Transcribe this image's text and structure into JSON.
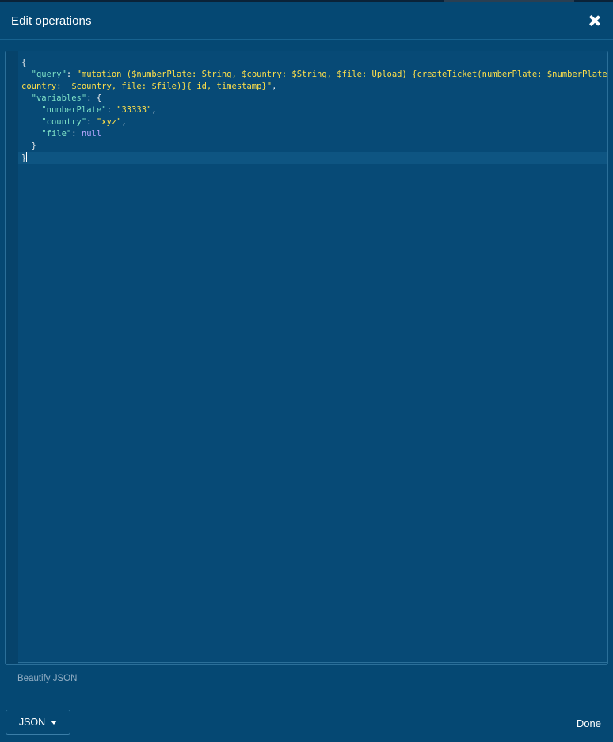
{
  "modal": {
    "title": "Edit operations",
    "close_icon": "close-icon"
  },
  "editor": {
    "lines": [
      [
        {
          "t": "punc",
          "v": "{"
        }
      ],
      [
        {
          "t": "punc",
          "v": "  "
        },
        {
          "t": "key",
          "v": "\"query\""
        },
        {
          "t": "punc",
          "v": ": "
        },
        {
          "t": "str",
          "v": "\"mutation ($numberPlate: String, $country: $String, $file: Upload) {createTicket(numberPlate: $numberPlate,"
        }
      ],
      [
        {
          "t": "str",
          "v": "country:  $country, file: $file)}{ id, timestamp}\""
        },
        {
          "t": "punc",
          "v": ","
        }
      ],
      [
        {
          "t": "punc",
          "v": "  "
        },
        {
          "t": "key",
          "v": "\"variables\""
        },
        {
          "t": "punc",
          "v": ": {"
        }
      ],
      [
        {
          "t": "punc",
          "v": "    "
        },
        {
          "t": "key",
          "v": "\"numberPlate\""
        },
        {
          "t": "punc",
          "v": ": "
        },
        {
          "t": "str",
          "v": "\"33333\""
        },
        {
          "t": "punc",
          "v": ","
        }
      ],
      [
        {
          "t": "punc",
          "v": "    "
        },
        {
          "t": "key",
          "v": "\"country\""
        },
        {
          "t": "punc",
          "v": ": "
        },
        {
          "t": "str",
          "v": "\"xyz\""
        },
        {
          "t": "punc",
          "v": ","
        }
      ],
      [
        {
          "t": "punc",
          "v": "    "
        },
        {
          "t": "key",
          "v": "\"file\""
        },
        {
          "t": "punc",
          "v": ": "
        },
        {
          "t": "null",
          "v": "null"
        }
      ],
      [
        {
          "t": "punc",
          "v": "  }"
        }
      ],
      [
        {
          "t": "punc",
          "v": "}"
        }
      ]
    ],
    "active_line": 8
  },
  "beautify_label": "Beautify JSON",
  "footer": {
    "format_label": "JSON",
    "done_label": "Done"
  }
}
